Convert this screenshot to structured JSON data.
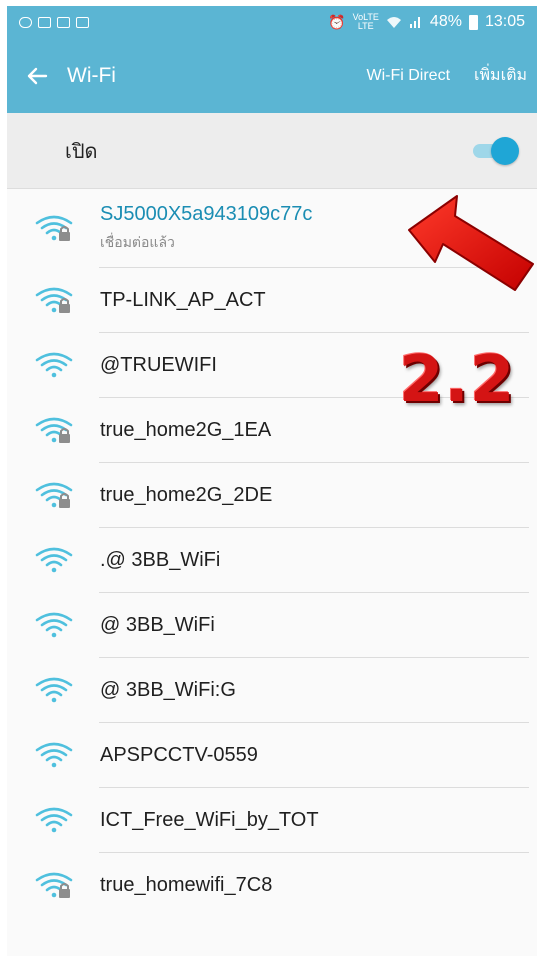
{
  "status_bar": {
    "battery": "48%",
    "time": "13:05",
    "network": "LTE",
    "network_sub": "VoLTE"
  },
  "app_bar": {
    "title": "Wi-Fi",
    "wifi_direct": "Wi-Fi Direct",
    "more": "เพิ่มเติม"
  },
  "wifi_toggle": {
    "label": "เปิด",
    "state": "on"
  },
  "networks": [
    {
      "ssid": "SJ5000X5a943109c77c",
      "status": "เชื่อมต่อแล้ว",
      "secured": true,
      "connected": true
    },
    {
      "ssid": "TP-LINK_AP_ACT",
      "secured": true
    },
    {
      "ssid": "@TRUEWIFI",
      "secured": false
    },
    {
      "ssid": "true_home2G_1EA",
      "secured": true
    },
    {
      "ssid": "true_home2G_2DE",
      "secured": true
    },
    {
      "ssid": ".@  3BB_WiFi",
      "secured": false
    },
    {
      "ssid": "@ 3BB_WiFi",
      "secured": false
    },
    {
      "ssid": "@ 3BB_WiFi:G",
      "secured": false
    },
    {
      "ssid": "APSPCCTV-0559",
      "secured": false
    },
    {
      "ssid": "ICT_Free_WiFi_by_TOT",
      "secured": false
    },
    {
      "ssid": "true_homewifi_7C8",
      "secured": true
    }
  ],
  "annotation": {
    "label": "2.2"
  },
  "colors": {
    "accent": "#5bb5d3",
    "connected_text": "#1b8db3",
    "wifi_icon": "#4fc0de",
    "annotation": "#e01a1a"
  },
  "icons": [
    "back-arrow-icon",
    "wifi-signal-icon",
    "lock-icon",
    "alarm-icon",
    "signal-bars-icon",
    "battery-icon"
  ]
}
